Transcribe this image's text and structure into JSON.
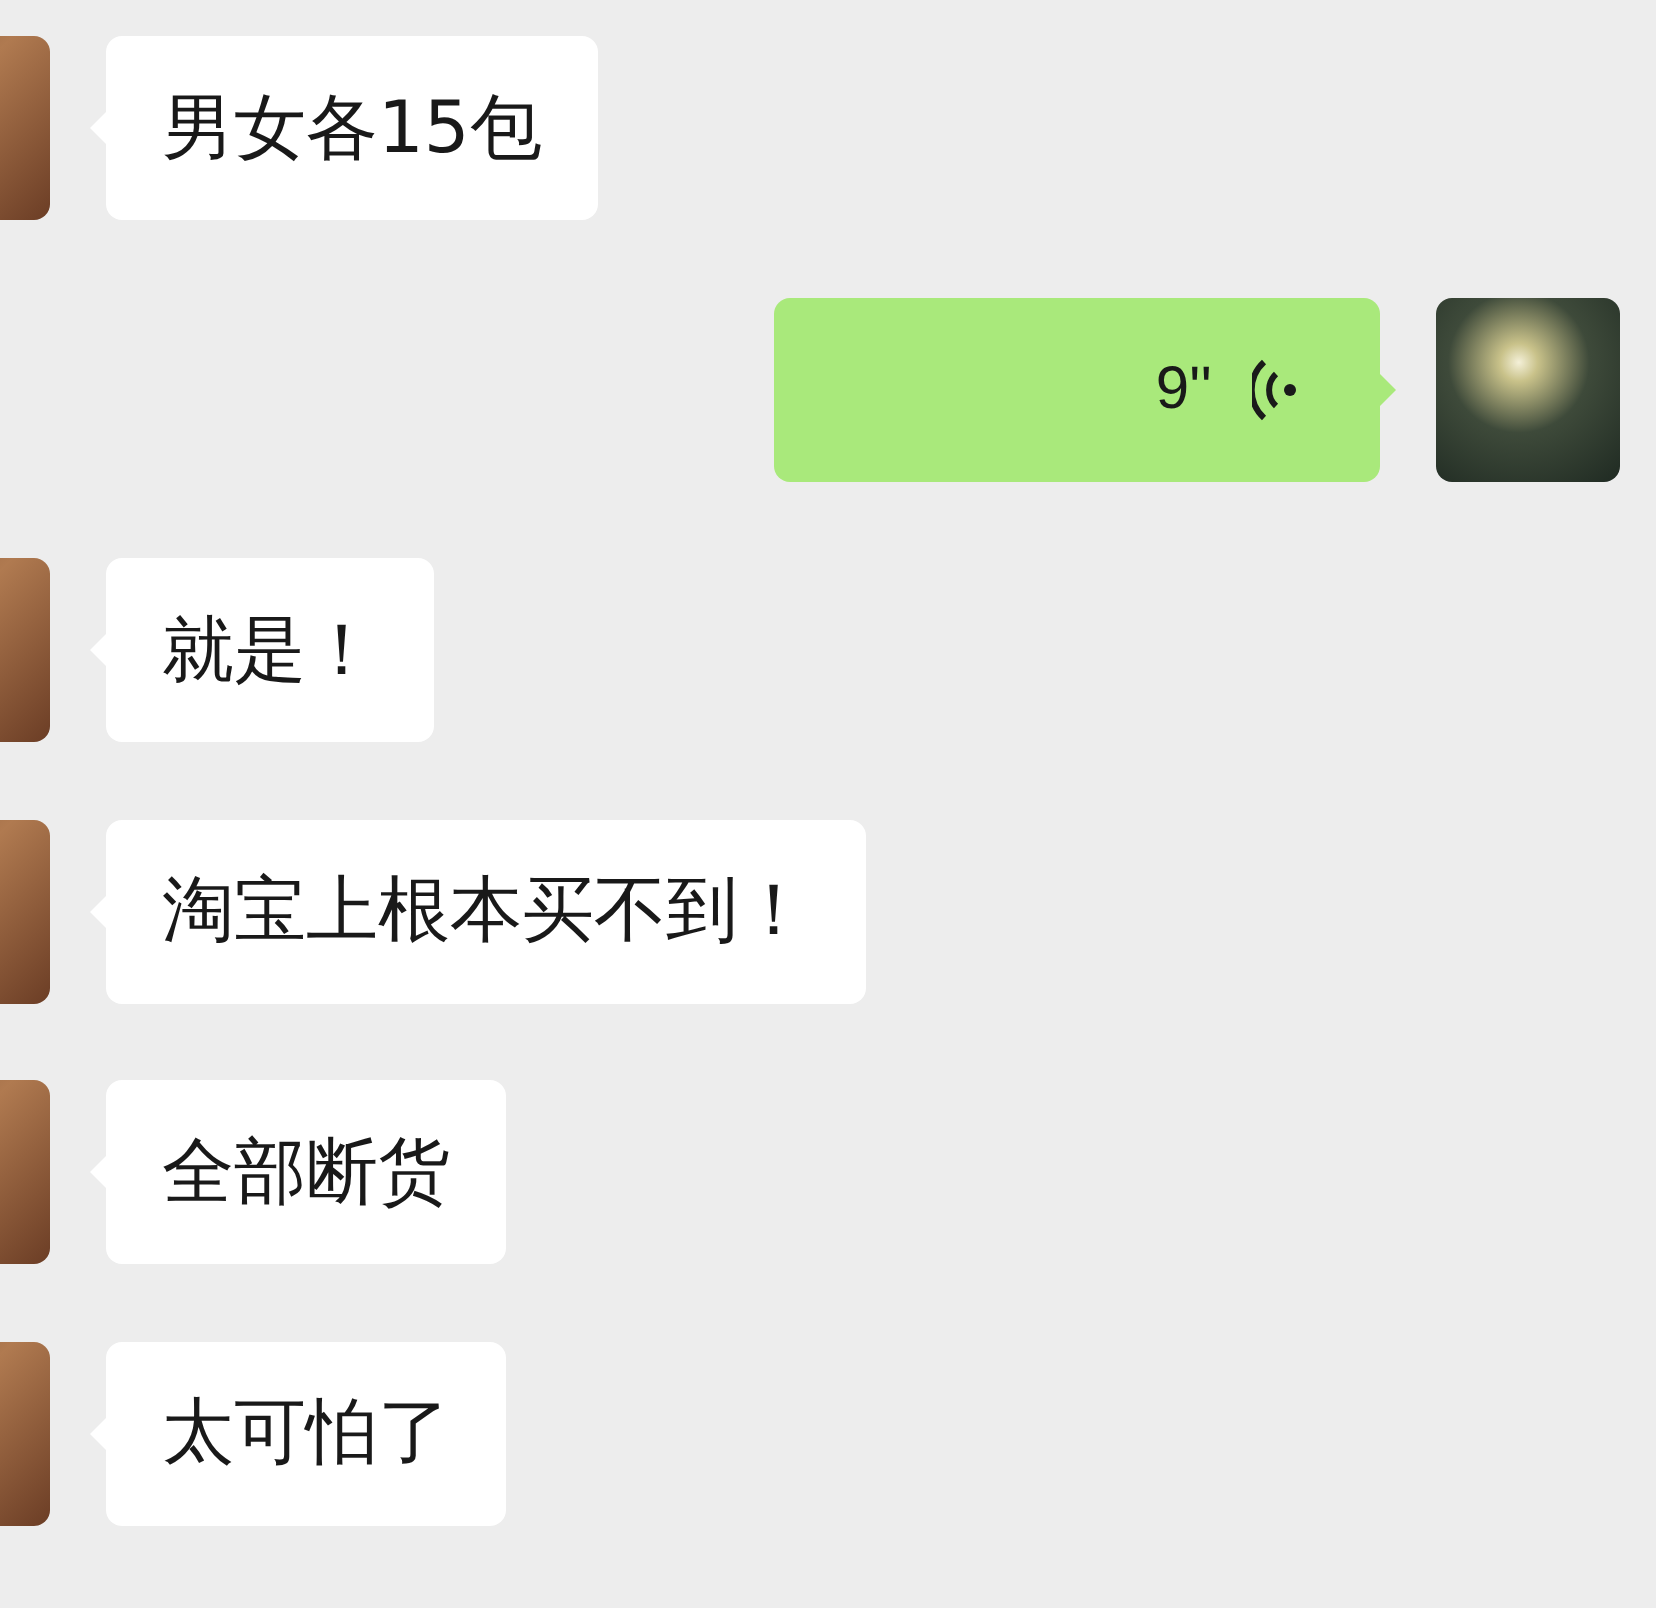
{
  "messages": [
    {
      "outgoing": false,
      "kind": "text",
      "text": "男女各15包"
    },
    {
      "outgoing": true,
      "kind": "voice",
      "text": "9''"
    },
    {
      "outgoing": false,
      "kind": "text",
      "text": "就是！"
    },
    {
      "outgoing": false,
      "kind": "text",
      "text": "淘宝上根本买不到！"
    },
    {
      "outgoing": false,
      "kind": "text",
      "text": "全部断货"
    },
    {
      "outgoing": false,
      "kind": "text",
      "text": "太可怕了"
    }
  ]
}
